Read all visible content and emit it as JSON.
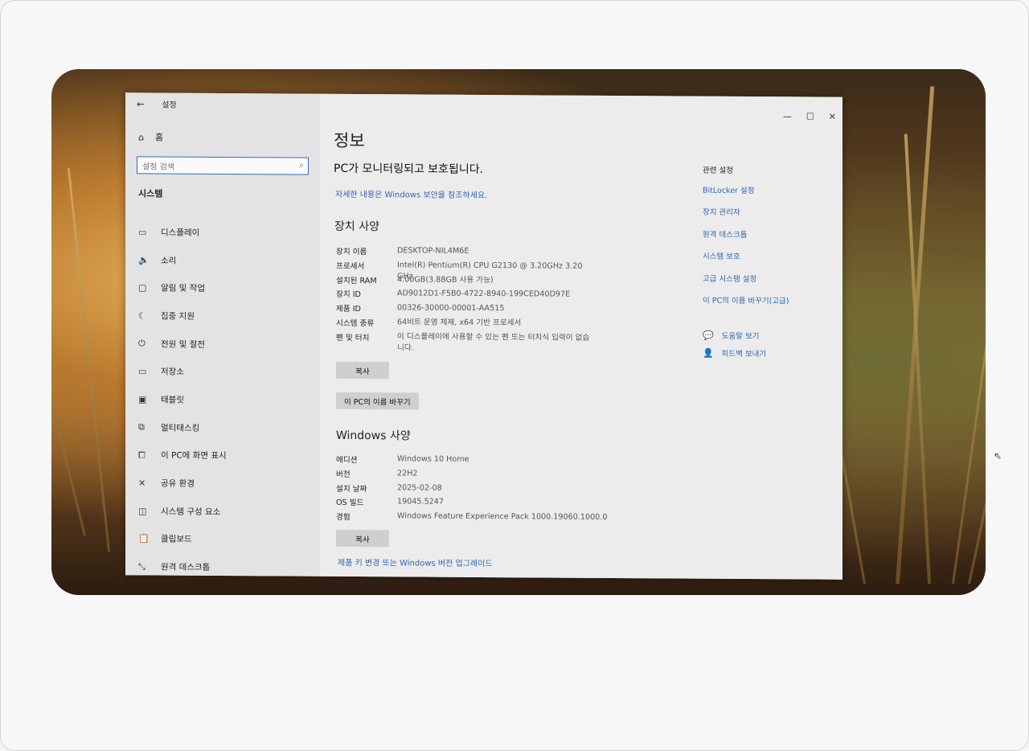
{
  "window": {
    "title": "설정",
    "back_glyph": "←",
    "controls": {
      "minimize": "—",
      "maximize": "☐",
      "close": "✕"
    }
  },
  "sidebar": {
    "home": {
      "icon": "home-icon",
      "glyph": "⌂",
      "label": "홈"
    },
    "search_placeholder": "설정 검색",
    "search_icon": "search-icon",
    "section": "시스템",
    "items": [
      {
        "icon": "display-icon",
        "glyph": "▭",
        "label": "디스플레이"
      },
      {
        "icon": "sound-icon",
        "glyph": "🔈",
        "label": "소리"
      },
      {
        "icon": "notification-icon",
        "glyph": "▢",
        "label": "알림 및 작업"
      },
      {
        "icon": "focus-assist-icon",
        "glyph": "☾",
        "label": "집중 지원"
      },
      {
        "icon": "power-icon",
        "glyph": "⏻",
        "label": "전원 및 절전"
      },
      {
        "icon": "storage-icon",
        "glyph": "▭",
        "label": "저장소"
      },
      {
        "icon": "tablet-icon",
        "glyph": "▣",
        "label": "태블릿"
      },
      {
        "icon": "multitasking-icon",
        "glyph": "⧉",
        "label": "멀티태스킹"
      },
      {
        "icon": "project-icon",
        "glyph": "⧠",
        "label": "이 PC에 화면 표시"
      },
      {
        "icon": "shared-experience-icon",
        "glyph": "✕",
        "label": "공유 환경"
      },
      {
        "icon": "system-components-icon",
        "glyph": "◫",
        "label": "시스템 구성 요소"
      },
      {
        "icon": "clipboard-icon",
        "glyph": "📋",
        "label": "클립보드"
      },
      {
        "icon": "remote-desktop-icon",
        "glyph": "⤡",
        "label": "원격 데스크톱"
      }
    ]
  },
  "main": {
    "title": "정보",
    "protection_status": "PC가 모니터링되고 보호됩니다.",
    "protection_link": "자세한 내용은 Windows 보안을 참조하세요.",
    "device_specs": {
      "heading": "장치 사양",
      "rows": [
        {
          "key": "장치 이름",
          "value": "DESKTOP-NIL4M6E"
        },
        {
          "key": "프로세서",
          "value": "Intel(R) Pentium(R) CPU G2130 @ 3.20GHz   3.20 GHz"
        },
        {
          "key": "설치된 RAM",
          "value": "4.00GB(3.88GB 사용 가능)"
        },
        {
          "key": "장치 ID",
          "value": "AD9012D1-F5B0-4722-8940-199CED40D97E"
        },
        {
          "key": "제품 ID",
          "value": "00326-30000-00001-AA515"
        },
        {
          "key": "시스템 종류",
          "value": "64비트 운영 체제, x64 기반 프로세서"
        },
        {
          "key": "펜 및 터치",
          "value": "이 디스플레이에 사용할 수 있는 펜 또는 터치식 입력이 없습니다."
        }
      ],
      "copy_button": "복사",
      "rename_button": "이 PC의 이름 바꾸기"
    },
    "windows_specs": {
      "heading": "Windows 사양",
      "rows": [
        {
          "key": "에디션",
          "value": "Windows 10 Home"
        },
        {
          "key": "버전",
          "value": "22H2"
        },
        {
          "key": "설치 날짜",
          "value": "2025-02-08"
        },
        {
          "key": "OS 빌드",
          "value": "19045.5247"
        },
        {
          "key": "경험",
          "value": "Windows Feature Experience Pack 1000.19060.1000.0"
        }
      ],
      "copy_button": "복사",
      "upgrade_link": "제품 키 변경 또는 Windows 버전 업그레이드"
    }
  },
  "related": {
    "title": "관련 설정",
    "links": [
      "BitLocker 설정",
      "장치 관리자",
      "원격 데스크톱",
      "시스템 보호",
      "고급 시스템 설정",
      "이 PC의 이름 바꾸기(고급)"
    ]
  },
  "help": {
    "items": [
      {
        "icon": "help-icon",
        "glyph": "💬",
        "label": "도움말 보기"
      },
      {
        "icon": "feedback-icon",
        "glyph": "👤",
        "label": "피드백 보내기"
      }
    ]
  },
  "colors": {
    "accent": "#2f64b3",
    "search_border": "#2f6bbf"
  }
}
